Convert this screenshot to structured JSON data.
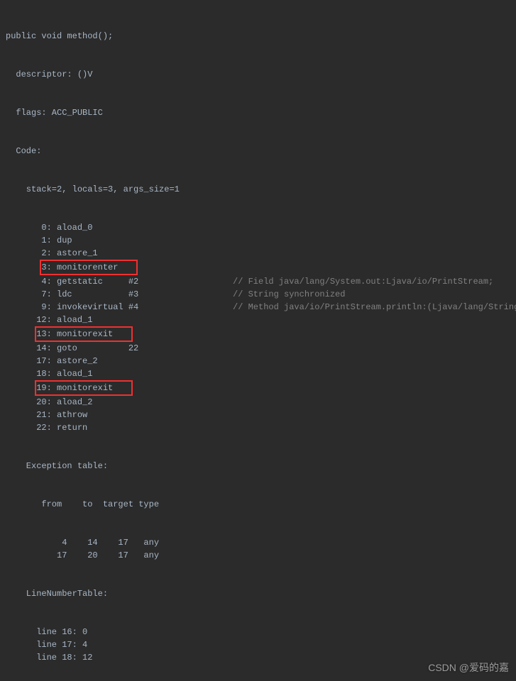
{
  "code": {
    "signature": "public void method();",
    "descriptor": "  descriptor: ()V",
    "flags": "  flags: ACC_PUBLIC",
    "codeLabel": "  Code:",
    "stack": "    stack=2, locals=3, args_size=1",
    "instructions": [
      {
        "left": "       0: aload_0",
        "right": ""
      },
      {
        "left": "       1: dup",
        "right": ""
      },
      {
        "left": "       2: astore_1",
        "right": ""
      },
      {
        "left": "       3: monitorenter",
        "right": "",
        "boxed": true
      },
      {
        "left": "       4: getstatic     #2",
        "right": "// Field java/lang/System.out:Ljava/io/PrintStream;"
      },
      {
        "left": "       7: ldc           #3",
        "right": "// String synchronized"
      },
      {
        "left": "       9: invokevirtual #4",
        "right": "// Method java/io/PrintStream.println:(Ljava/lang/String;)V"
      },
      {
        "left": "      12: aload_1",
        "right": ""
      },
      {
        "left": "      13: monitorexit",
        "right": "",
        "boxed": true
      },
      {
        "left": "      14: goto          22",
        "right": ""
      },
      {
        "left": "      17: astore_2",
        "right": ""
      },
      {
        "left": "      18: aload_1",
        "right": ""
      },
      {
        "left": "      19: monitorexit",
        "right": "",
        "boxed": true
      },
      {
        "left": "      20: aload_2",
        "right": ""
      },
      {
        "left": "      21: athrow",
        "right": ""
      },
      {
        "left": "      22: return",
        "right": ""
      }
    ],
    "exceptionTableLabel": "    Exception table:",
    "exceptionHeader": "       from    to  target type",
    "exceptionRows": [
      "           4    14    17   any",
      "          17    20    17   any"
    ],
    "lineNumberTableLabel": "    LineNumberTable:",
    "lineNumberRows": [
      "      line 16: 0",
      "      line 17: 4",
      "      line 18: 12"
    ]
  },
  "watermark": "CSDN @爱码的嘉"
}
